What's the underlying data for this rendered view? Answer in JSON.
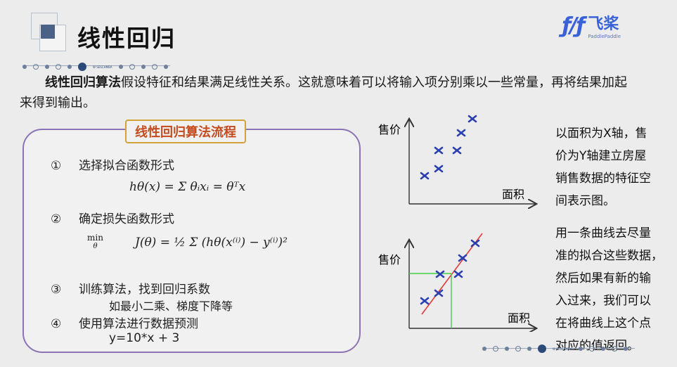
{
  "header": {
    "title": "线性回归",
    "dots_label": "W SESCHMBA"
  },
  "brand": {
    "mark": "ƒ/ƒ",
    "name": "飞桨",
    "sub": "PaddlePaddle"
  },
  "intro": {
    "bold": "线性回归算法",
    "text": "假设特征和结果满足线性关系。这就意味着可以将输入项分别乘以一些常量，再将结果加起来得到输出。"
  },
  "flow": {
    "title": "线性回归算法流程",
    "steps": [
      {
        "num": "①",
        "label": "选择拟合函数形式"
      },
      {
        "num": "②",
        "label": "确定损失函数形式"
      },
      {
        "num": "③",
        "label": "训练算法，找到回归系数",
        "sub": "如最小二乘、梯度下降等"
      },
      {
        "num": "④",
        "label": "使用算法进行数据预测",
        "sub": "y=10*x + 3"
      }
    ],
    "formula1": "hθ(x) = Σ θᵢxᵢ = θᵀx",
    "formula2_min": "min",
    "formula2_var": "θ",
    "formula2": "J(θ) = ½ Σ (hθ(x⁽ⁱ⁾) − y⁽ⁱ⁾)²"
  },
  "plots": {
    "y_label": "售价",
    "x_label": "面积",
    "desc1": [
      "以面积为X轴，售",
      "价为Y轴建立房屋",
      "销售数据的特征空",
      "间表示图。"
    ],
    "desc2": [
      "用一条曲线去尽量",
      "准的拟合这些数据，",
      "然后如果有新的输",
      "入过来，我们可以",
      "在将曲线上这个点",
      "对应的值返回。"
    ]
  },
  "colors": {
    "accent": "#3a62d8",
    "frame": "#8a74b3",
    "title_text": "#c44b1e",
    "marker": "#2a3fb0",
    "fit_line": "#e03a3a",
    "guide": "#45d045"
  }
}
